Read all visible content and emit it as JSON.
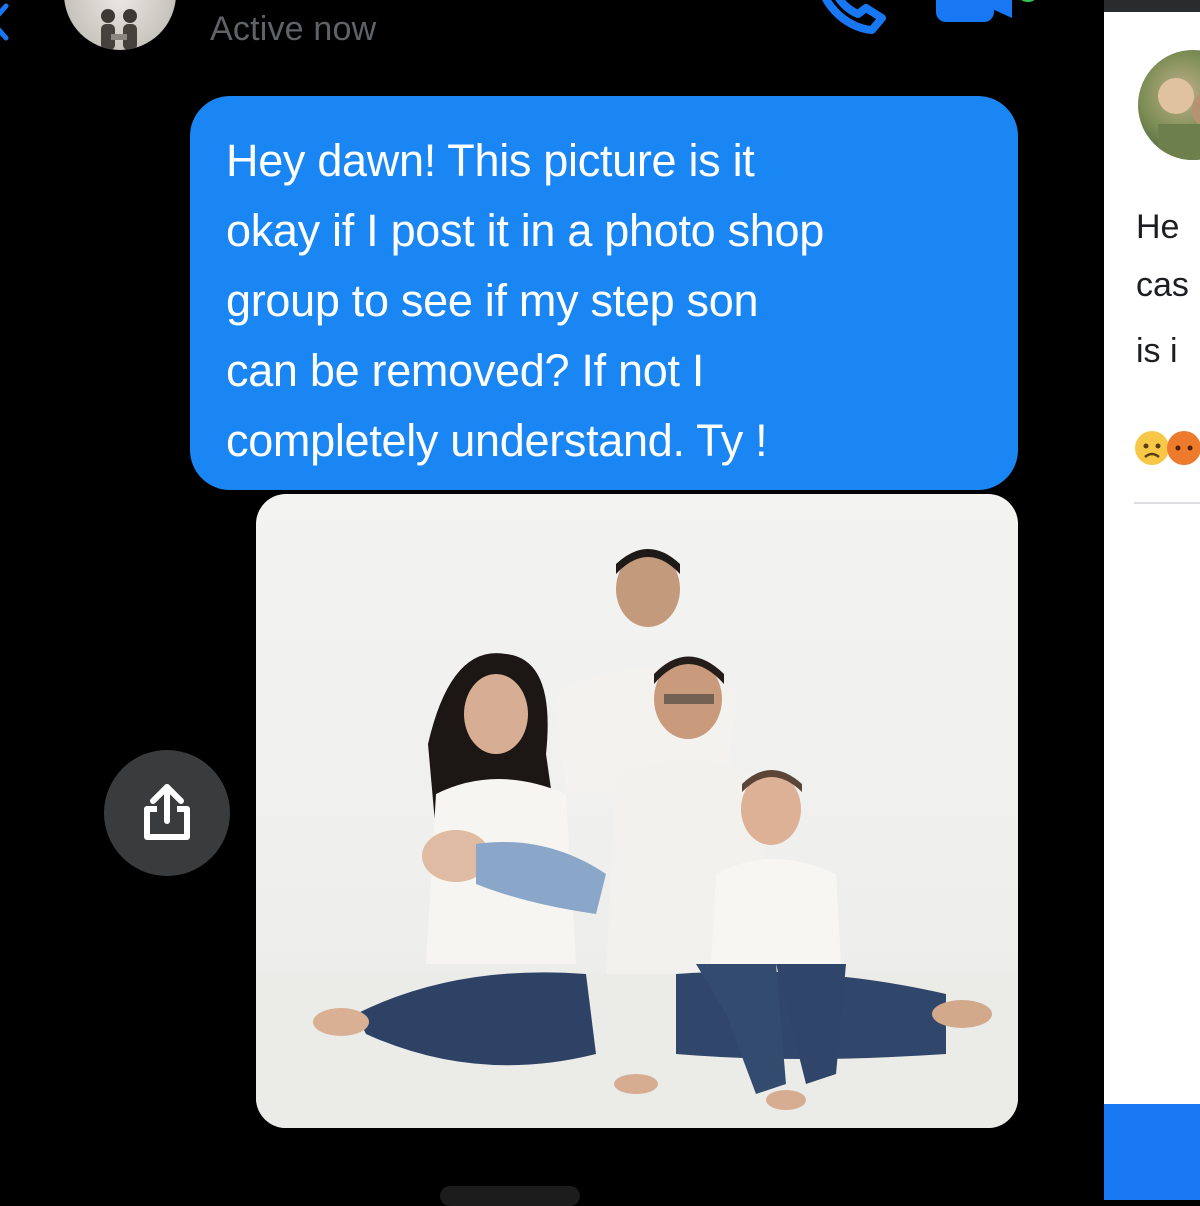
{
  "header": {
    "status": "Active now",
    "call_icon": "phone-icon",
    "video_icon": "video-camera-icon",
    "back_icon": "chevron-left-icon",
    "active_color": "#31c553"
  },
  "conversation": {
    "message": {
      "text": "Hey dawn! This picture is it okay if I post it in a photo shop group to see if my step son can be removed? If not I completely understand. Ty !",
      "lines": [
        "Hey dawn! This picture is it",
        "okay if I post it in a photo shop",
        "group to see if my step son",
        "can be removed? If not I",
        "completely understand. Ty !"
      ],
      "bubble_color": "#1a86f4"
    },
    "attachment": {
      "kind": "photo",
      "subject": "family portrait"
    },
    "share_icon": "share-icon"
  },
  "side_panel": {
    "text_lines": [
      "He",
      "cas",
      "is i"
    ],
    "reaction_icons": [
      "sad-emoji-icon",
      "angry-emoji-icon"
    ],
    "button_color": "#1877f2"
  }
}
